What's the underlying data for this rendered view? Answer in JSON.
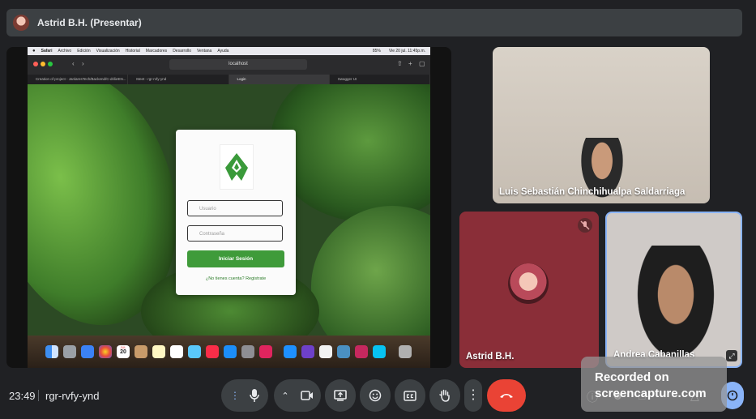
{
  "top_bar": {
    "presenter_label": "Astrid B.H. (Presentar)"
  },
  "shared_screen": {
    "menubar": {
      "apple": "",
      "app": "Safari",
      "items": [
        "Archivo",
        "Edición",
        "Visualización",
        "Historial",
        "Marcadores",
        "Desarrollo",
        "Ventana",
        "Ayuda"
      ],
      "battery": "85%",
      "clock": "Vie 20 jul. 11:45p.m."
    },
    "url": "localhost",
    "tabs": [
      "Creation of project - JanlaresTech/Backend/C-drilieEN...",
      "Meet - rgr-rvfy-ynd",
      "Login",
      "Swagger UI"
    ],
    "active_tab_index": 2,
    "login": {
      "username_placeholder": "Usuario",
      "password_placeholder": "Contraseña",
      "submit_label": "Iniciar Sesión",
      "register_link": "¿No tienes cuenta? Registrate"
    },
    "dock_calendar": {
      "month": "JUL",
      "day": "20"
    }
  },
  "participants": {
    "luis": {
      "name": "Luis Sebastián Chinchihualpa Saldarriaga"
    },
    "astrid": {
      "name": "Astrid B.H.",
      "muted": true
    },
    "andrea": {
      "name": "Andrea Cabanillas"
    }
  },
  "bottom_bar": {
    "time": "23:49",
    "meeting_code": "rgr-rvfy-ynd"
  },
  "watermark": {
    "line1": "Recorded on",
    "line2": "screencapture.com"
  },
  "colors": {
    "background": "#202124",
    "control": "#3c4043",
    "end_call": "#ea4335",
    "login_button": "#3f9b3a",
    "active_tile_border": "#8ab4f8"
  }
}
